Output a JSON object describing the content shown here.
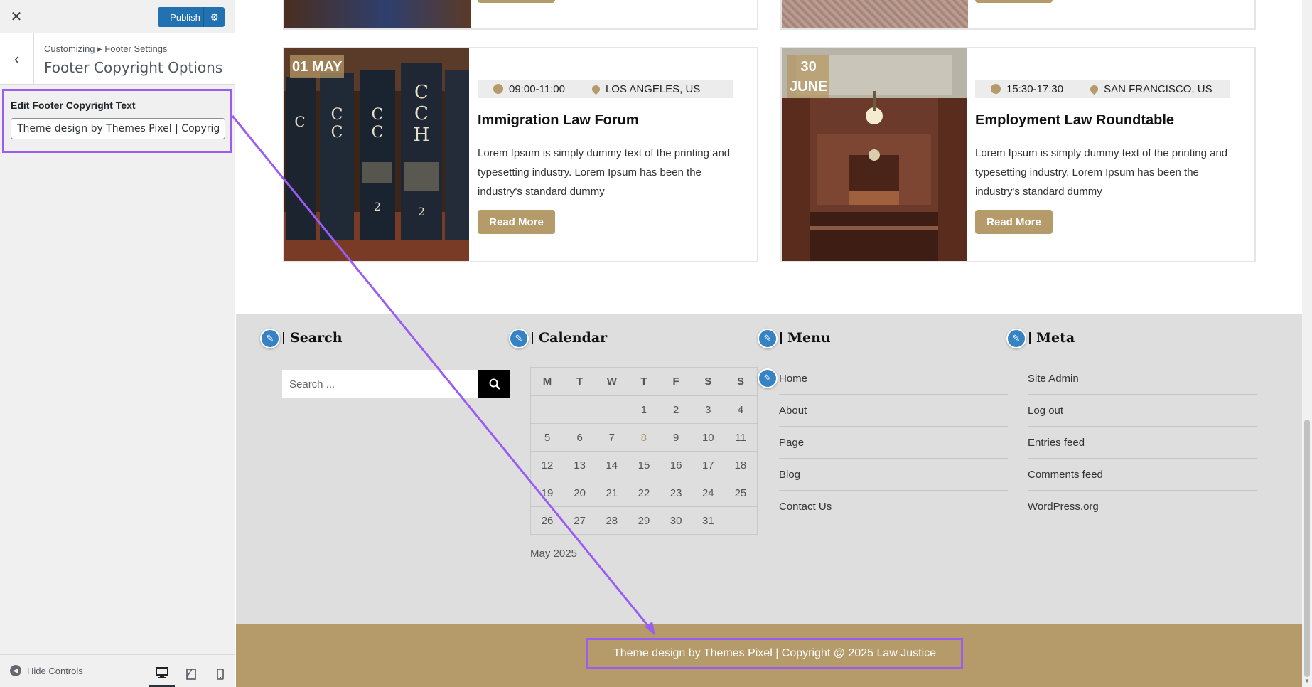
{
  "customizer": {
    "close_icon": "✕",
    "publish_label": "Publish",
    "settings_icon": "⚙",
    "back_icon": "‹",
    "breadcrumb": "Customizing ▸ Footer Settings",
    "section_title": "Footer Copyright Options",
    "field_label": "Edit Footer Copyright Text",
    "field_value": "Theme design by Themes Pixel | Copyright @ 2025 Law Justice",
    "hide_controls": "Hide Controls",
    "accent_color": "#2271b1",
    "highlight_color": "#9b5cf2"
  },
  "events": [
    {
      "date": "01 MAY",
      "time": "09:00-11:00",
      "location": "LOS ANGELES, US",
      "title": "Immigration Law Forum",
      "text": "Lorem Ipsum is simply dummy text of the printing and typesetting industry. Lorem Ipsum has been the industry's standard dummy",
      "button": "Read More"
    },
    {
      "date_line1": "30",
      "date_line2": "JUNE",
      "time": "15:30-17:30",
      "location": "SAN FRANCISCO, US",
      "title": "Employment Law Roundtable",
      "text": "Lorem Ipsum is simply dummy text of the printing and typesetting industry. Lorem Ipsum has been the industry's standard dummy",
      "button": "Read More"
    }
  ],
  "widgets": {
    "search": {
      "title": "Search",
      "placeholder": "Search ..."
    },
    "calendar": {
      "title": "Calendar",
      "days": [
        "M",
        "T",
        "W",
        "T",
        "F",
        "S",
        "S"
      ],
      "weeks": [
        [
          "",
          "",
          "",
          "1",
          "2",
          "3",
          "4"
        ],
        [
          "5",
          "6",
          "7",
          "8",
          "9",
          "10",
          "11"
        ],
        [
          "12",
          "13",
          "14",
          "15",
          "16",
          "17",
          "18"
        ],
        [
          "19",
          "20",
          "21",
          "22",
          "23",
          "24",
          "25"
        ],
        [
          "26",
          "27",
          "28",
          "29",
          "30",
          "31",
          ""
        ]
      ],
      "linked_day": "8",
      "caption": "May 2025"
    },
    "menu": {
      "title": "Menu",
      "items": [
        "Home",
        "About",
        "Page",
        "Blog",
        "Contact Us"
      ]
    },
    "meta": {
      "title": "Meta",
      "items": [
        "Site Admin",
        "Log out",
        "Entries feed",
        "Comments feed",
        "WordPress.org"
      ]
    }
  },
  "footer": {
    "copyright": "Theme design by Themes Pixel | Copyright @ 2025 Law Justice",
    "brand_color": "#b59a6a"
  }
}
